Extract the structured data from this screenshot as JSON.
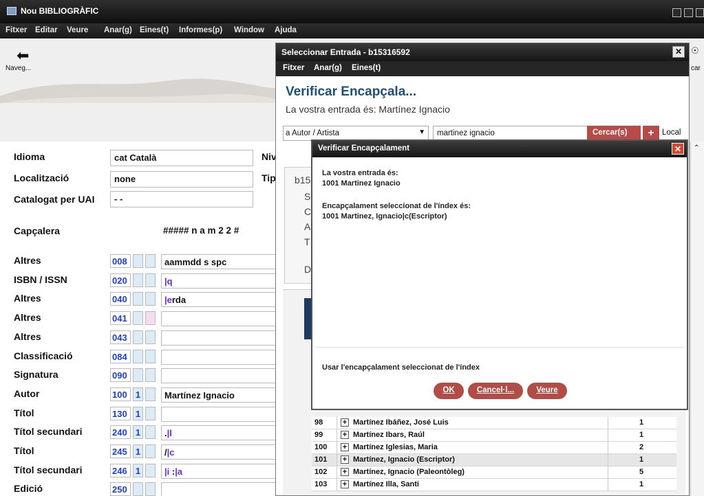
{
  "app": {
    "title": "Nou BIBLIOGRÀFIC"
  },
  "menu": [
    "Fitxer",
    "Editar",
    "Veure",
    "Anar(g)",
    "Eines(t)",
    "Informes(p)",
    "Window",
    "Ajuda"
  ],
  "toolbar": {
    "nav_label": "Naveg...",
    "right_label": "car"
  },
  "form": {
    "idioma_label": "Idioma",
    "idioma_value": "cat Català",
    "loc_label": "Localització",
    "loc_value": "none",
    "cat_label": "Catalogat per UAI",
    "cat_value": "- -",
    "niv_label": "Niv",
    "tip_label": "Tip",
    "cap_label": "Capçalera",
    "cap_value": "##### n a m    2 2 #",
    "fields": [
      {
        "label": "Altres",
        "tag": "008",
        "i1": "",
        "i2": "",
        "value": "aammdd s          spc"
      },
      {
        "label": "ISBN / ISSN",
        "tag": "020",
        "i1": "",
        "i2": "",
        "value": "|q"
      },
      {
        "label": "Altres",
        "tag": "040",
        "i1": "",
        "i2": "",
        "value": "|erda"
      },
      {
        "label": "Altres",
        "tag": "041",
        "i1": "",
        "i2": "",
        "value": ""
      },
      {
        "label": "Altres",
        "tag": "043",
        "i1": "",
        "i2": "",
        "value": ""
      },
      {
        "label": "Classificació",
        "tag": "084",
        "i1": "",
        "i2": "",
        "value": ""
      },
      {
        "label": "Signatura",
        "tag": "090",
        "i1": "",
        "i2": "",
        "value": ""
      },
      {
        "label": "Autor",
        "tag": "100",
        "i1": "1",
        "i2": "",
        "value": "Martínez Ignacio"
      },
      {
        "label": "Títol",
        "tag": "130",
        "i1": "1",
        "i2": "",
        "value": ""
      },
      {
        "label": "Títol secundari",
        "tag": "240",
        "i1": "1",
        "i2": "",
        "value": ".|l"
      },
      {
        "label": "Títol",
        "tag": "245",
        "i1": "1",
        "i2": "",
        "value": " /|c"
      },
      {
        "label": "Títol secundari",
        "tag": "246",
        "i1": "1",
        "i2": "",
        "value": "|i :|a"
      },
      {
        "label": "Edició",
        "tag": "250",
        "i1": "",
        "i2": "",
        "value": ""
      }
    ]
  },
  "select_window": {
    "title": "Seleccionar Entrada - b15316592",
    "menu": [
      "Fitxer",
      "Anar(g)",
      "Eines(t)"
    ],
    "heading": "Verificar Encapçala...",
    "entry_line": "La vostra entrada és: Martínez Ignacio",
    "field_select": "a Autor / Artista",
    "search_value": "martinez ignacio",
    "search_button": "Cercar(s)",
    "plus_button": "+",
    "local_label": "Local",
    "detail_id": "b15",
    "detail_letters": [
      "S",
      "C",
      "A",
      "T",
      "D"
    ],
    "index_rows": [
      {
        "num": "98",
        "name": "Martínez Ibáñez, José Luis",
        "count": "1"
      },
      {
        "num": "99",
        "name": "Martínez Ibars, Raúl",
        "count": "1"
      },
      {
        "num": "100",
        "name": "Martínez Iglesias, Maria",
        "count": "2"
      },
      {
        "num": "101",
        "name": "Martínez, Ignacio (Escriptor)",
        "count": "1"
      },
      {
        "num": "102",
        "name": "Martínez, Ignacio (Paleontòleg)",
        "count": "5"
      },
      {
        "num": "103",
        "name": "Martínez Illa, Santi",
        "count": "1"
      }
    ]
  },
  "dialog": {
    "title": "Verificar Encapçalament",
    "entry_label": "La vostra entrada és:",
    "entry_value": "1001  Martinez Ignacio",
    "index_label": "Encapçalament seleccionat de l'índex és:",
    "index_value": "1001  Martinez, Ignacio|c(Escriptor)",
    "use_text": "Usar l'encapçalament seleccionat de l'índex",
    "ok": "OK",
    "cancel": "Cancel·l...",
    "view": "Veure"
  }
}
